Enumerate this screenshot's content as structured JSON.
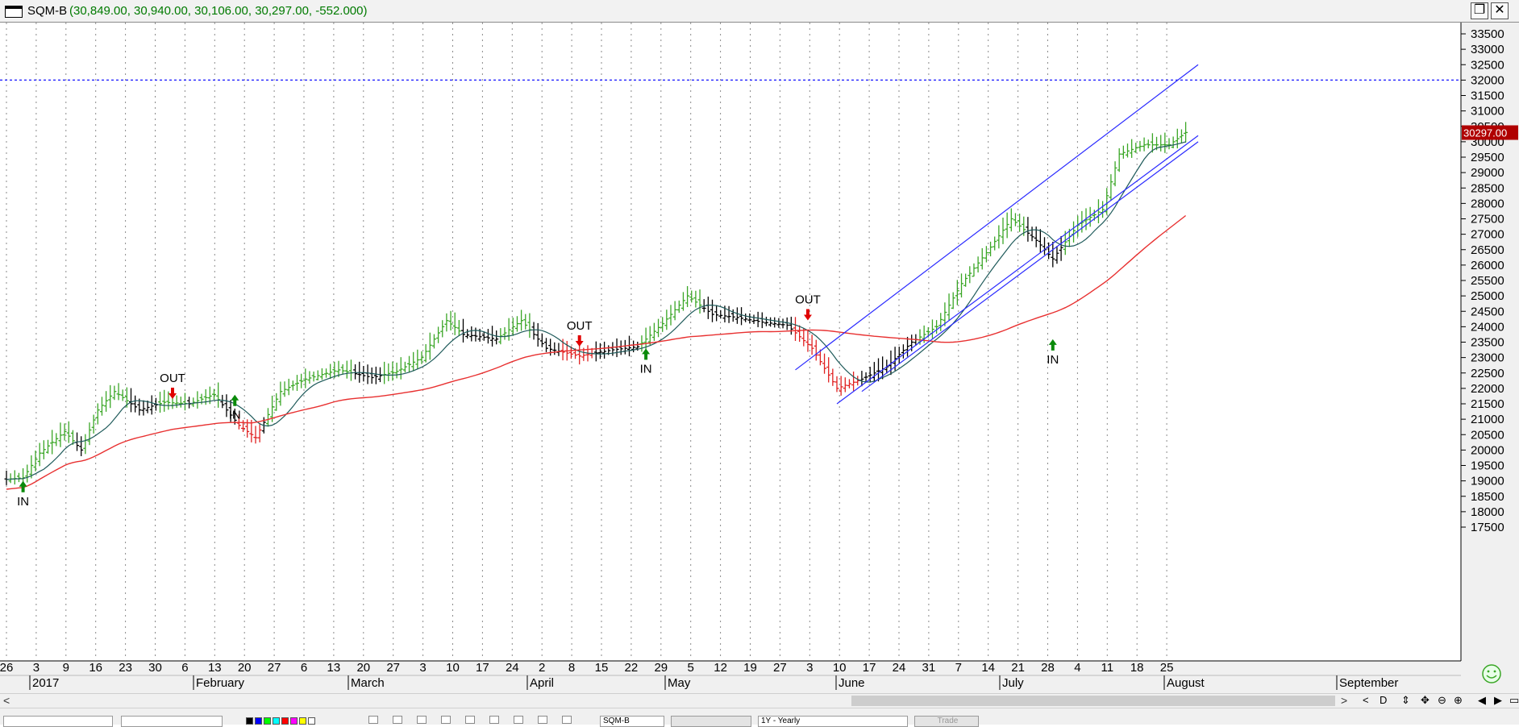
{
  "window": {
    "symbol": "SQM-B",
    "quote": "(30,849.00, 30,940.00, 30,106.00, 30,297.00, -552.000)"
  },
  "chart_data": {
    "type": "bar",
    "title": "SQM-B",
    "ylim": [
      17000,
      33900
    ],
    "y_ticks": [
      17500,
      18000,
      18500,
      19000,
      19500,
      20000,
      20500,
      21000,
      21500,
      22000,
      22500,
      23000,
      23500,
      24000,
      24500,
      25000,
      25500,
      26000,
      26500,
      27000,
      27500,
      28000,
      28500,
      29000,
      29500,
      30000,
      30500,
      31000,
      31500,
      32000,
      32500,
      33000,
      33500
    ],
    "last_price_label": "30297.00",
    "last_price": 30297,
    "horizontal_line": 32000,
    "day_ticks": [
      "26",
      "3",
      "9",
      "16",
      "23",
      "30",
      "6",
      "13",
      "20",
      "27",
      "6",
      "13",
      "20",
      "27",
      "3",
      "10",
      "17",
      "24",
      "2",
      "8",
      "15",
      "22",
      "29",
      "5",
      "12",
      "19",
      "27",
      "3",
      "10",
      "17",
      "24",
      "31",
      "7",
      "14",
      "21",
      "28",
      "4",
      "11",
      "18",
      "25"
    ],
    "month_labels": [
      "2017",
      "February",
      "March",
      "April",
      "May",
      "June",
      "July",
      "August",
      "September"
    ],
    "ohlc_anchors": [
      [
        0,
        19050
      ],
      [
        4,
        19100
      ],
      [
        8,
        19900
      ],
      [
        14,
        20600
      ],
      [
        18,
        20000
      ],
      [
        22,
        21300
      ],
      [
        26,
        21900
      ],
      [
        32,
        21300
      ],
      [
        38,
        21550
      ],
      [
        44,
        21500
      ],
      [
        50,
        21800
      ],
      [
        56,
        20800
      ],
      [
        60,
        20400
      ],
      [
        66,
        21900
      ],
      [
        72,
        22300
      ],
      [
        80,
        22600
      ],
      [
        88,
        22350
      ],
      [
        94,
        22550
      ],
      [
        100,
        23000
      ],
      [
        106,
        24200
      ],
      [
        110,
        23750
      ],
      [
        118,
        23600
      ],
      [
        124,
        24200
      ],
      [
        130,
        23300
      ],
      [
        138,
        23050
      ],
      [
        146,
        23250
      ],
      [
        152,
        23350
      ],
      [
        158,
        24100
      ],
      [
        164,
        25000
      ],
      [
        170,
        24400
      ],
      [
        176,
        24300
      ],
      [
        182,
        24150
      ],
      [
        188,
        24050
      ],
      [
        194,
        23300
      ],
      [
        200,
        22000
      ],
      [
        206,
        22300
      ],
      [
        212,
        22700
      ],
      [
        218,
        23500
      ],
      [
        224,
        24000
      ],
      [
        230,
        25400
      ],
      [
        236,
        26400
      ],
      [
        242,
        27500
      ],
      [
        248,
        26800
      ],
      [
        252,
        26200
      ],
      [
        258,
        27300
      ],
      [
        264,
        27800
      ],
      [
        268,
        29600
      ],
      [
        274,
        29900
      ],
      [
        280,
        29900
      ],
      [
        284,
        30300
      ]
    ],
    "signals": [
      {
        "type": "IN",
        "idx": 4,
        "price": 19100
      },
      {
        "type": "OUT",
        "idx": 40,
        "price": 21500
      },
      {
        "type": "IN",
        "idx": 55,
        "price": 21900
      },
      {
        "type": "OUT",
        "idx": 138,
        "price": 23200
      },
      {
        "type": "IN",
        "idx": 154,
        "price": 23400
      },
      {
        "type": "OUT",
        "idx": 193,
        "price": 24050
      },
      {
        "type": "IN",
        "idx": 252,
        "price": 23700
      }
    ],
    "channel": {
      "upper": [
        [
          190,
          22600
        ],
        [
          287,
          32500
        ]
      ],
      "lower": [
        [
          200,
          21500
        ],
        [
          287,
          30200
        ]
      ],
      "mid": [
        [
          206,
          21900
        ],
        [
          287,
          30000
        ]
      ]
    },
    "colors": {
      "up": "#3aa626",
      "down": "#e02020",
      "neutral": "#000000",
      "ma_short": "#1e5a5a",
      "ma_long": "#e83030",
      "channel": "#2a2aff",
      "hline": "#3030ff",
      "grid": "#8a8a8a"
    }
  },
  "toolbar": {
    "symbol_box": "SQM-B",
    "yearly_box": "1Y - Yearly",
    "trade_button": "Trade"
  },
  "status": {
    "ok_icon": "smiley-icon"
  }
}
